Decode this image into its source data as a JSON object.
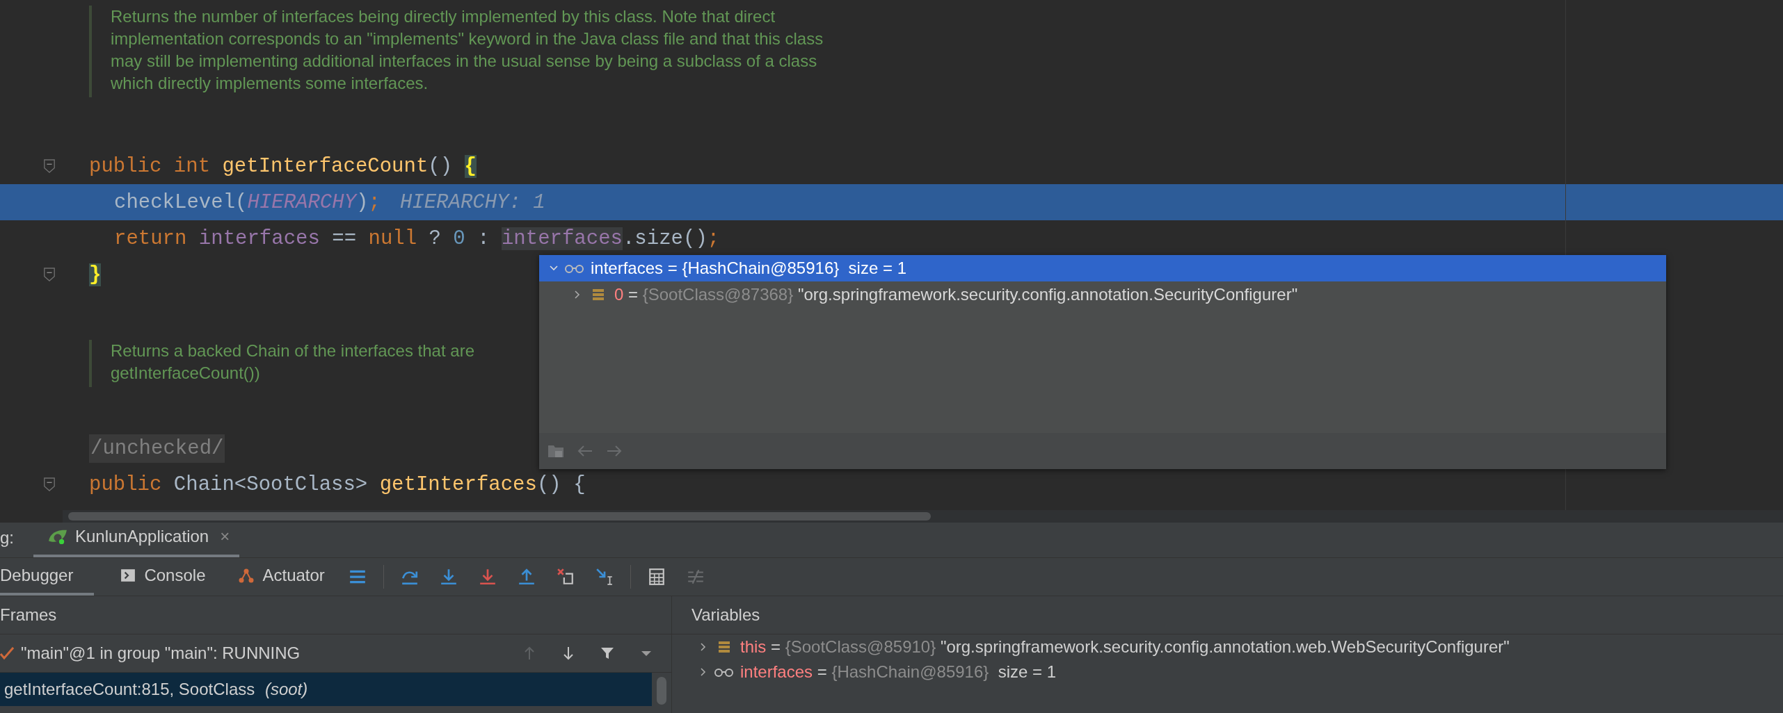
{
  "editor": {
    "blocks": [
      {
        "kind": "doc",
        "lines": [
          "Returns the number of interfaces being directly implemented by this class. Note that direct",
          "implementation corresponds to an \"implements\" keyword in the Java class file and that this class",
          "may still be implementing additional interfaces in the usual sense by being a subclass of a class",
          "which directly implements some interfaces."
        ]
      },
      {
        "kind": "code",
        "fold": true,
        "indented": false,
        "highlighted": false,
        "tokens": [
          {
            "kind": "keyword",
            "text": "public "
          },
          {
            "kind": "keyword",
            "text": "int "
          },
          {
            "kind": "method",
            "text": "getInterfaceCount"
          },
          {
            "kind": "plain",
            "text": "() "
          },
          {
            "kind": "brace_match",
            "text": "{"
          }
        ]
      },
      {
        "kind": "code",
        "fold": false,
        "indented": true,
        "highlighted": true,
        "tokens": [
          {
            "kind": "plain",
            "text": "checkLevel("
          },
          {
            "kind": "constant",
            "text": "HIERARCHY"
          },
          {
            "kind": "plain",
            "text": ")"
          },
          {
            "kind": "keyword",
            "text": ";"
          },
          {
            "kind": "hint",
            "text": "HIERARCHY: 1"
          }
        ]
      },
      {
        "kind": "code",
        "fold": false,
        "indented": true,
        "highlighted": false,
        "tokens": [
          {
            "kind": "keyword",
            "text": "return "
          },
          {
            "kind": "field",
            "text": "interfaces "
          },
          {
            "kind": "plain",
            "text": "== "
          },
          {
            "kind": "keyword",
            "text": "null "
          },
          {
            "kind": "plain",
            "text": "? "
          },
          {
            "kind": "number",
            "text": "0 "
          },
          {
            "kind": "plain",
            "text": ": "
          },
          {
            "kind": "hover",
            "text": "interfaces"
          },
          {
            "kind": "plain",
            "text": ".size()"
          },
          {
            "kind": "keyword",
            "text": ";"
          }
        ]
      },
      {
        "kind": "code",
        "fold": true,
        "indented": false,
        "highlighted": false,
        "tokens": [
          {
            "kind": "brace_match",
            "text": "}"
          }
        ]
      },
      {
        "kind": "doc",
        "lines": [
          "Returns a backed Chain of the interfaces that are",
          "getInterfaceCount())"
        ]
      },
      {
        "kind": "annotation",
        "text": "/unchecked/"
      },
      {
        "kind": "code",
        "fold": true,
        "indented": false,
        "highlighted": false,
        "tokens": [
          {
            "kind": "keyword",
            "text": "public "
          },
          {
            "kind": "plain",
            "text": "Chain<SootClass> "
          },
          {
            "kind": "method",
            "text": "getInterfaces"
          },
          {
            "kind": "plain",
            "text": "() {"
          }
        ]
      }
    ]
  },
  "popup": {
    "header": {
      "expanded": true,
      "selected": true,
      "name": "interfaces",
      "sep": "=",
      "value": "{HashChain@85916}",
      "extra": "size = 1"
    },
    "children": [
      {
        "expanded": false,
        "name": "0",
        "sep": "=",
        "type": "{SootClass@87368}",
        "value": "\"org.springframework.security.config.annotation.SecurityConfigurer\""
      }
    ]
  },
  "debug": {
    "label": "g:",
    "session_tab": {
      "label": "KunlunApplication",
      "close": "×"
    },
    "tabs": [
      {
        "label": "Debugger",
        "selected": true
      },
      {
        "label": "Console",
        "selected": false
      },
      {
        "label": "Actuator",
        "selected": false
      }
    ],
    "frames": {
      "title": "Frames",
      "thread": "\"main\"@1 in group \"main\": RUNNING",
      "rows": [
        {
          "text": "getInterfaceCount:815, SootClass *(soot)*",
          "selected": true
        }
      ]
    },
    "variables": {
      "title": "Variables",
      "rows": [
        {
          "kind": "object",
          "name": "this",
          "sep": "=",
          "type": "{SootClass@85910}",
          "value": "\"org.springframework.security.config.annotation.web.WebSecurityConfigurer\""
        },
        {
          "kind": "watch",
          "name": "interfaces",
          "sep": "=",
          "type": "{HashChain@85916}",
          "value": "size = 1"
        }
      ]
    }
  }
}
